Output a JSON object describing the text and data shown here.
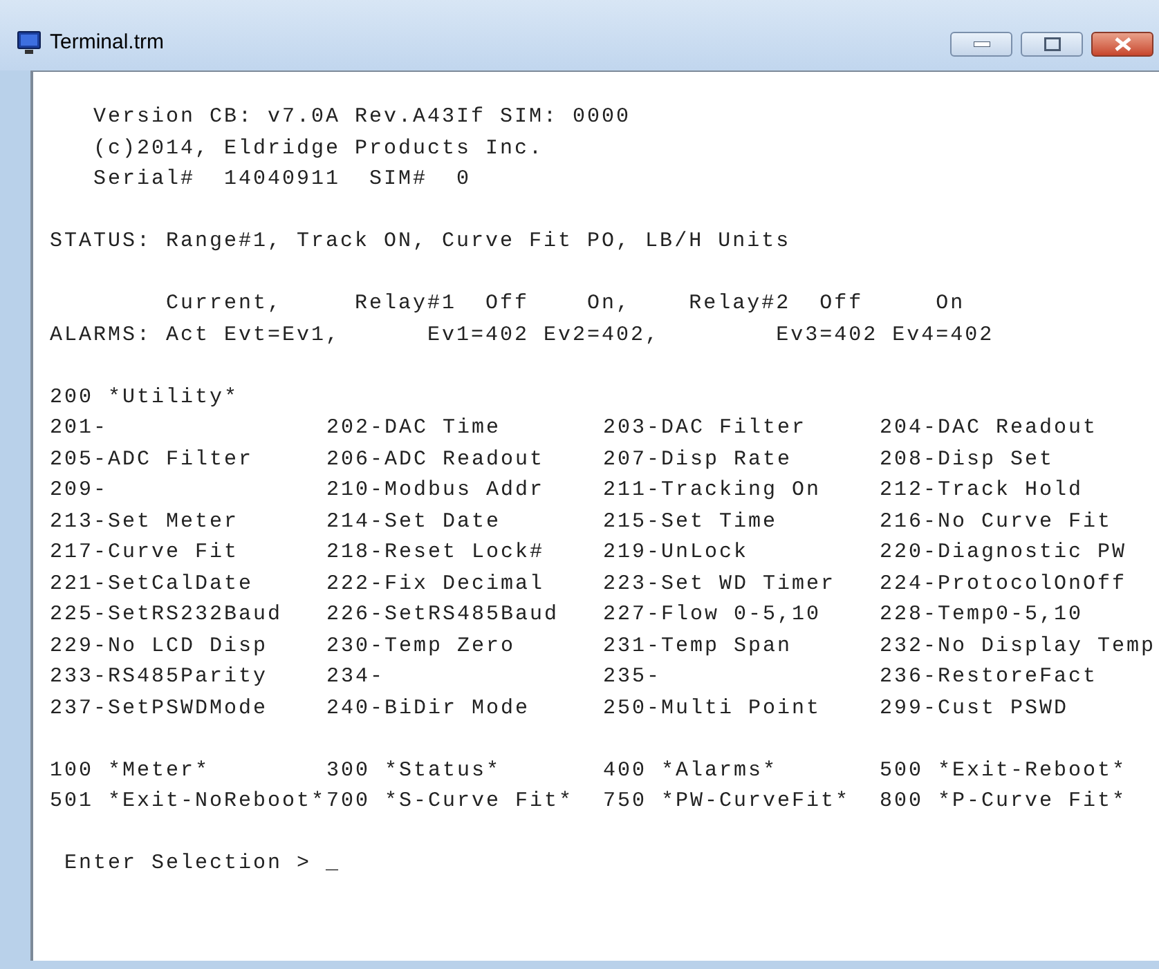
{
  "window": {
    "title": "Terminal.trm"
  },
  "header_lines": [
    "   Version CB: v7.0A Rev.A43If SIM: 0000",
    "   (c)2014, Eldridge Products Inc.",
    "   Serial#  14040911  SIM#  0"
  ],
  "status_line": "STATUS: Range#1, Track ON, Curve Fit PO, LB/H Units",
  "alarm_lines": [
    "        Current,     Relay#1  Off    On,    Relay#2  Off     On",
    "ALARMS: Act Evt=Ev1,      Ev1=402 Ev2=402,        Ev3=402 Ev4=402"
  ],
  "utility_heading": "200 *Utility*",
  "menu_rows": [
    [
      "201-",
      "202-DAC Time",
      "203-DAC Filter",
      "204-DAC Readout"
    ],
    [
      "205-ADC Filter",
      "206-ADC Readout",
      "207-Disp Rate",
      "208-Disp Set"
    ],
    [
      "209-",
      "210-Modbus Addr",
      "211-Tracking On",
      "212-Track Hold"
    ],
    [
      "213-Set Meter",
      "214-Set Date",
      "215-Set Time",
      "216-No Curve Fit"
    ],
    [
      "217-Curve Fit",
      "218-Reset Lock#",
      "219-UnLock",
      "220-Diagnostic PW"
    ],
    [
      "221-SetCalDate",
      "222-Fix Decimal",
      "223-Set WD Timer",
      "224-ProtocolOnOff"
    ],
    [
      "225-SetRS232Baud",
      "226-SetRS485Baud",
      "227-Flow 0-5,10",
      "228-Temp0-5,10"
    ],
    [
      "229-No LCD Disp",
      "230-Temp Zero",
      "231-Temp Span",
      "232-No Display Temp"
    ],
    [
      "233-RS485Parity",
      "234-",
      "235-",
      "236-RestoreFact"
    ],
    [
      "237-SetPSWDMode",
      "240-BiDir Mode",
      "250-Multi Point",
      "299-Cust PSWD"
    ]
  ],
  "shortcut_rows": [
    [
      "100 *Meter*",
      "300 *Status*",
      "400 *Alarms*",
      "500 *Exit-Reboot*"
    ],
    [
      "501 *Exit-NoReboot*",
      "700 *S-Curve Fit*",
      "750 *PW-CurveFit*",
      "800 *P-Curve Fit*"
    ]
  ],
  "prompt": " Enter Selection > _"
}
